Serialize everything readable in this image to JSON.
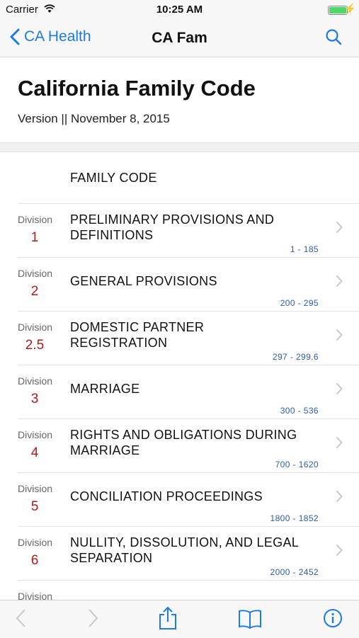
{
  "status": {
    "carrier": "Carrier",
    "time": "10:25 AM"
  },
  "nav": {
    "back_label": "CA Health",
    "title": "CA Fam"
  },
  "header": {
    "title": "California Family Code",
    "version": "Version || November 8, 2015"
  },
  "list": {
    "heading": "FAMILY CODE",
    "division_label": "Division",
    "rows": [
      {
        "num": "1",
        "title": "PRELIMINARY PROVISIONS AND DEFINITIONS",
        "range": "1 - 185"
      },
      {
        "num": "2",
        "title": "GENERAL PROVISIONS",
        "range": "200 - 295"
      },
      {
        "num": "2.5",
        "title": "DOMESTIC PARTNER REGISTRATION",
        "range": "297 - 299.6"
      },
      {
        "num": "3",
        "title": "MARRIAGE",
        "range": "300 - 536"
      },
      {
        "num": "4",
        "title": "RIGHTS AND OBLIGATIONS DURING MARRIAGE",
        "range": "700 - 1620"
      },
      {
        "num": "5",
        "title": "CONCILIATION PROCEEDINGS",
        "range": "1800 - 1852"
      },
      {
        "num": "6",
        "title": "NULLITY, DISSOLUTION, AND LEGAL SEPARATION",
        "range": "2000 - 2452"
      },
      {
        "num": "",
        "title": "",
        "range": ""
      }
    ]
  },
  "colors": {
    "accent": "#1f7ae0",
    "division_number": "#b01c1c",
    "range": "#2b5da8"
  },
  "icons": [
    "wifi-icon",
    "battery-icon",
    "back-chevron-icon",
    "search-icon",
    "chevron-right-icon",
    "back-arrow-icon",
    "forward-arrow-icon",
    "share-icon",
    "bookmarks-icon",
    "info-icon"
  ]
}
